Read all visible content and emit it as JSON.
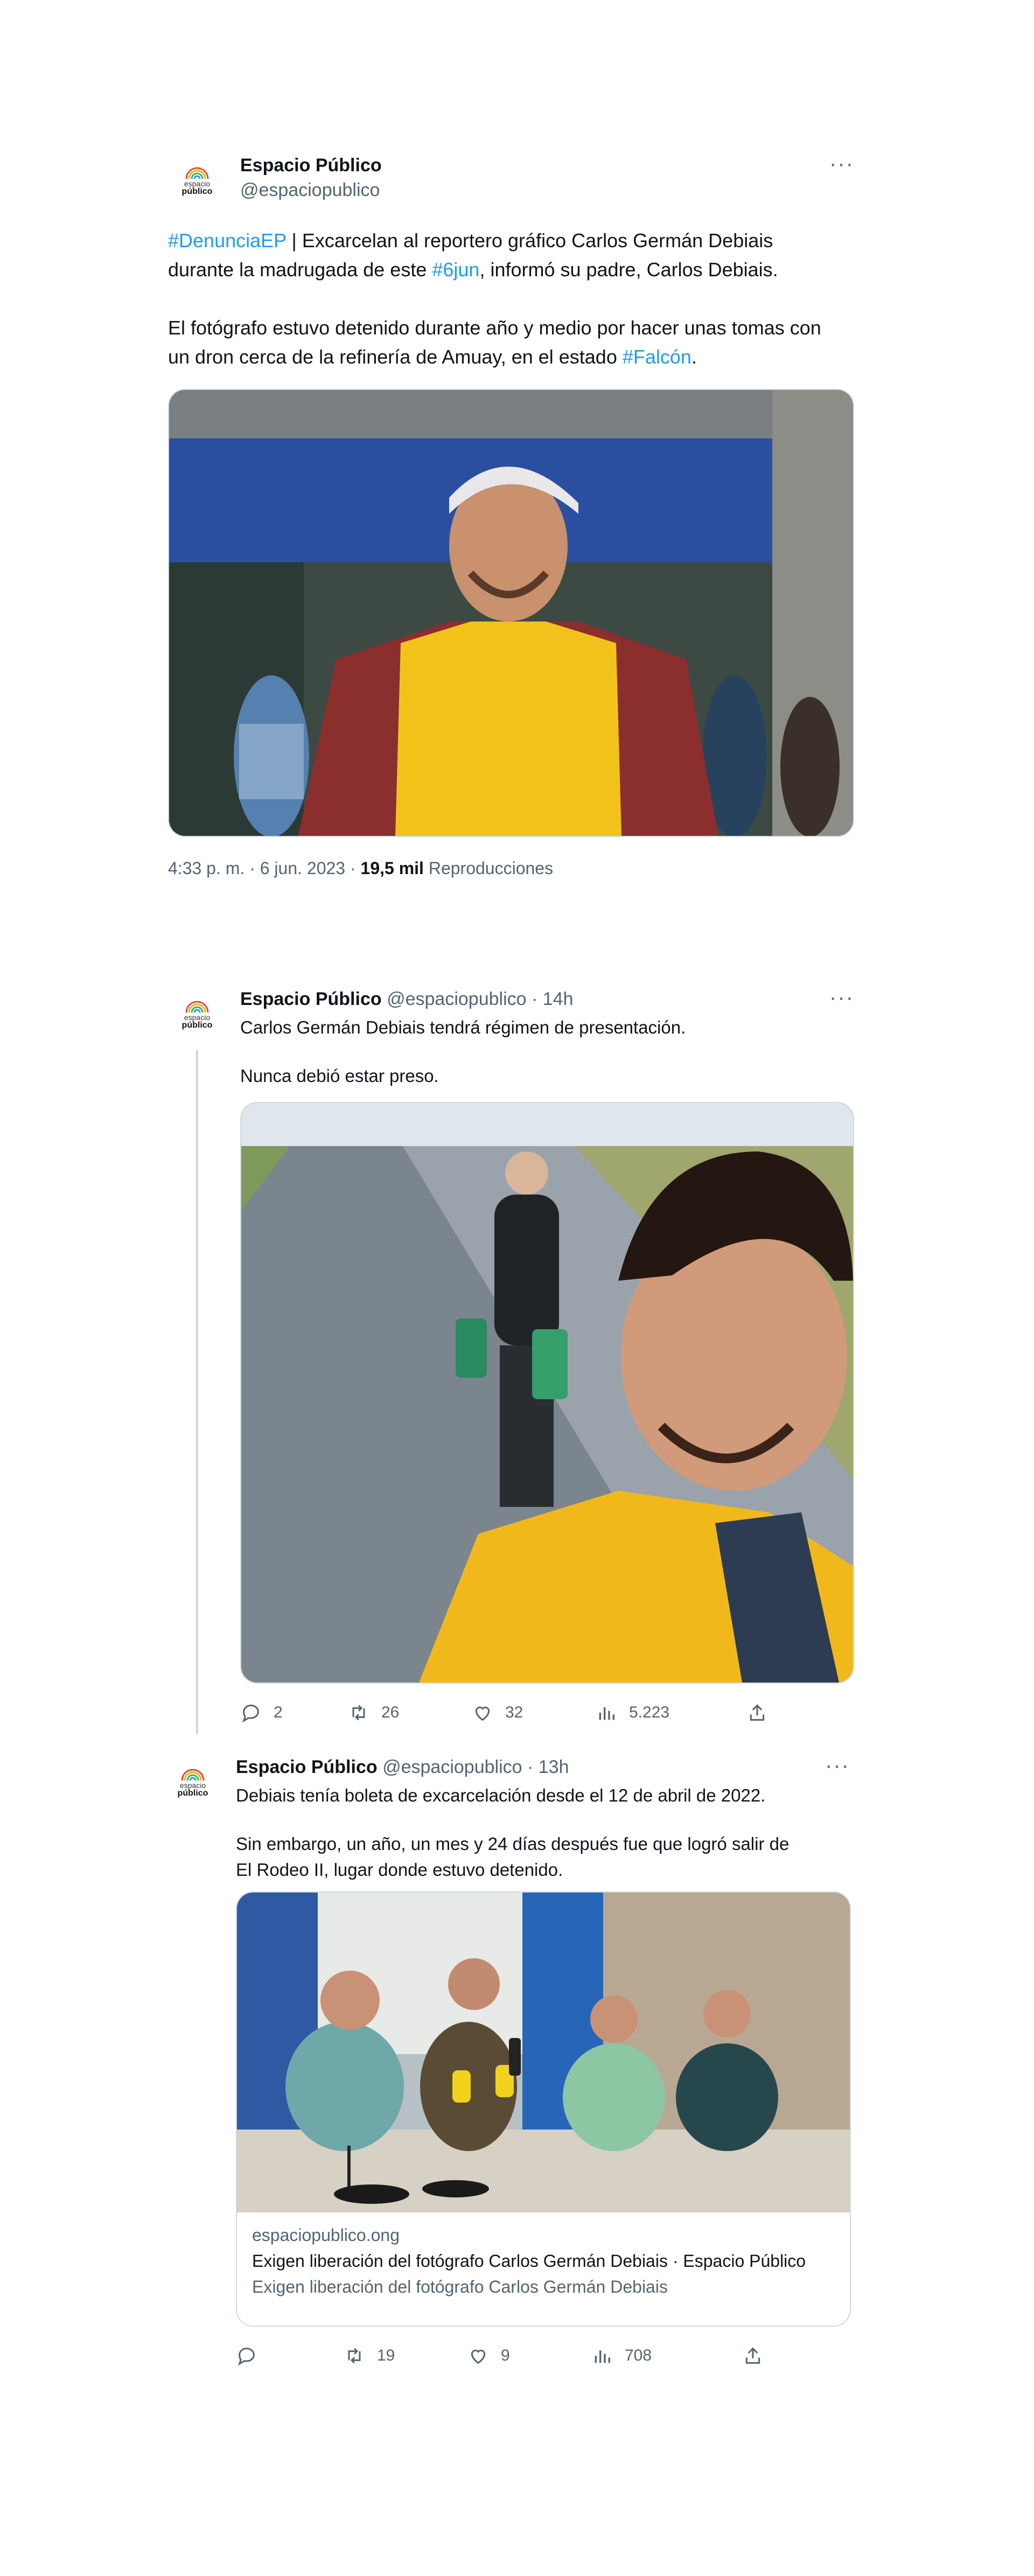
{
  "account": {
    "name": "Espacio Público",
    "handle": "@espaciopublico",
    "logo_line1": "espacio",
    "logo_line2": "público"
  },
  "main_tweet": {
    "more": "···",
    "paragraph1": [
      {
        "text": "#DenunciaEP",
        "link": true
      },
      {
        "text": " | Excarcelan al reportero gráfico Carlos Germán Debiais durante la madrugada de este ",
        "link": false
      },
      {
        "text": "#6jun",
        "link": true
      },
      {
        "text": ", informó su padre, Carlos Debiais.",
        "link": false
      }
    ],
    "paragraph2": [
      {
        "text": "El fotógrafo estuvo detenido durante año y medio por hacer unas tomas con un dron cerca de la refinería de Amuay, en el estado ",
        "link": false
      },
      {
        "text": "#Falcón",
        "link": true
      },
      {
        "text": ".",
        "link": false
      }
    ],
    "timestamp": "4:33 p. m. · 6 jun. 2023 · ",
    "views_count": "19,5 mil",
    "views_label": " Reproducciones"
  },
  "reply1": {
    "time": " · 14h",
    "line1": "Carlos Germán Debiais tendrá régimen de presentación.",
    "line2": "Nunca debió estar preso.",
    "actions": {
      "replies": "2",
      "retweets": "26",
      "likes": "32",
      "views": "5.223"
    }
  },
  "reply2": {
    "time": " · 13h",
    "line1": "Debiais tenía boleta de excarcelación desde el 12 de abril de 2022.",
    "line2": "Sin embargo, un año, un mes y 24 días después fue que logró salir de El Rodeo II, lugar donde estuvo detenido.",
    "card_domain": "espaciopublico.ong",
    "card_title": "Exigen liberación del fotógrafo Carlos Germán Debiais · Espacio Público",
    "card_desc": "Exigen liberación del fotógrafo Carlos Germán Debiais",
    "actions": {
      "replies": "",
      "retweets": "19",
      "likes": "9",
      "views": "708"
    }
  },
  "icons": {
    "reply": "reply-icon",
    "retweet": "retweet-icon",
    "like": "like-icon",
    "views": "views-icon",
    "share": "share-icon"
  },
  "colors": {
    "link": "#1d9bf0",
    "secondary": "#536471",
    "text": "#0f1419",
    "border": "#cfd9de"
  }
}
